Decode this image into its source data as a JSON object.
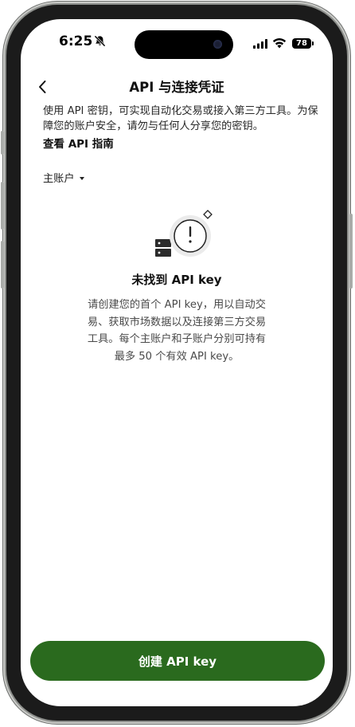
{
  "status_bar": {
    "time": "6:25",
    "battery": "78"
  },
  "nav": {
    "title": "API 与连接凭证"
  },
  "intro": {
    "description": "使用 API 密钥，可实现自动化交易或接入第三方工具。为保障您的账户安全，请勿与任何人分享您的密钥。",
    "guide_link": "查看 API 指南"
  },
  "account_selector": {
    "value": "主账户"
  },
  "empty_state": {
    "title": "未找到 API key",
    "description": "请创建您的首个 API key，用以自动交易、获取市场数据以及连接第三方交易工具。每个主账户和子账户分别可持有最多 50 个有效 API key。"
  },
  "primary_action": {
    "label": "创建 API key",
    "color": "#2a6a1e"
  },
  "icons": [
    "bell-slash-icon",
    "signal-icon",
    "wifi-icon",
    "battery-icon",
    "back-chevron-icon",
    "caret-down-icon",
    "server-alert-icon"
  ]
}
